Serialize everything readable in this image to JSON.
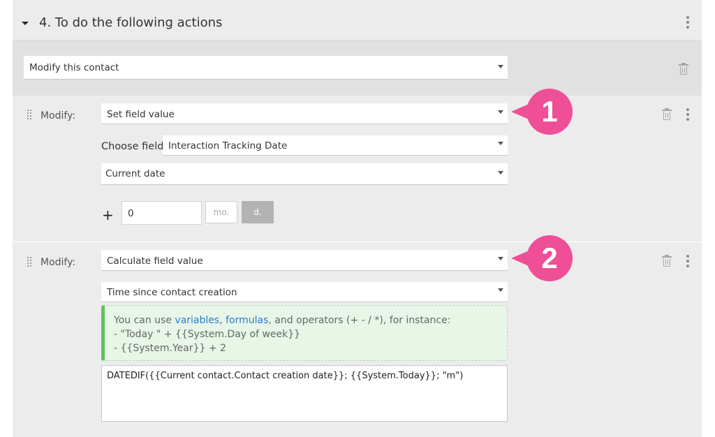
{
  "section": {
    "title": "4. To do the following actions"
  },
  "action": {
    "selected": "Modify this contact"
  },
  "modify_blocks": [
    {
      "label": "Modify:",
      "mode": "Set field value",
      "choose_field_label": "Choose field:",
      "field": "Interaction Tracking Date",
      "value_source": "Current date",
      "plus_sign": "+",
      "offset_value": "0",
      "unit_month": "mo.",
      "unit_day": "d.",
      "selected_unit": "d.",
      "badge": "1"
    },
    {
      "label": "Modify:",
      "mode": "Calculate field value",
      "field": "Time since contact creation",
      "hint": {
        "prefix": "You can use ",
        "link_variables": "variables",
        "comma": ", ",
        "link_formulas": "formulas",
        "suffix": ", and operators (+ - / *), for instance:",
        "example1": "- \"Today \" + {{System.Day of week}}",
        "example2": "- {{System.Year}} + 2"
      },
      "formula": "DATEDIF({{Current contact.Contact creation date}}; {{System.Today}}; \"m\")",
      "badge": "2"
    }
  ],
  "icons": {
    "collapse": "caret-down-icon",
    "more": "kebab-menu-icon",
    "delete": "trash-icon",
    "drag": "drag-handle-icon"
  },
  "colors": {
    "badge": "#ef4f97",
    "hint_accent": "#5cc45c",
    "link": "#2a7bd1",
    "selected_unit": "#b3b3b3"
  }
}
